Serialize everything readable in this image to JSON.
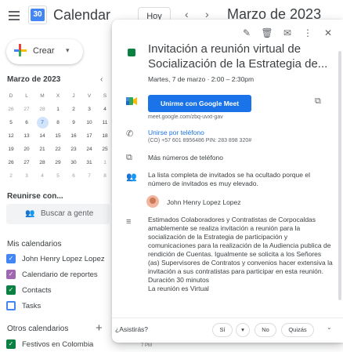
{
  "header": {
    "app_title": "Calendar",
    "logo_number": "30",
    "today_label": "Hoy",
    "prev": "‹",
    "next": "›",
    "month_title": "Marzo de 2023"
  },
  "sidebar": {
    "create_label": "Crear",
    "mini_title": "Marzo de 2023",
    "weekdays": [
      "D",
      "L",
      "M",
      "X",
      "J",
      "V",
      "S"
    ],
    "weeks": [
      [
        "26",
        "27",
        "28",
        "1",
        "2",
        "3",
        "4"
      ],
      [
        "5",
        "6",
        "7",
        "8",
        "9",
        "10",
        "11"
      ],
      [
        "12",
        "13",
        "14",
        "15",
        "16",
        "17",
        "18"
      ],
      [
        "19",
        "20",
        "21",
        "22",
        "23",
        "24",
        "25"
      ],
      [
        "26",
        "27",
        "28",
        "29",
        "30",
        "31",
        "1"
      ],
      [
        "2",
        "3",
        "4",
        "5",
        "6",
        "7",
        "8"
      ]
    ],
    "selected_day": "7",
    "find_title": "Reunirse con...",
    "find_label": "Buscar a gente",
    "my_calendars_title": "Mis calendarios",
    "my_calendars": [
      {
        "label": "John Henry Lopez Lopez",
        "color": "#4285f4",
        "checked": true
      },
      {
        "label": "Calendario de reportes",
        "color": "#9e69af",
        "checked": true
      },
      {
        "label": "Contacts",
        "color": "#0b8043",
        "checked": true
      },
      {
        "label": "Tasks",
        "color": "#4285f4",
        "checked": false
      }
    ],
    "other_calendars_title": "Otros calendarios",
    "other_calendars": [
      {
        "label": "Festivos en Colombia",
        "color": "#0b8043",
        "checked": true
      }
    ]
  },
  "time_hint": "7 PM",
  "event": {
    "color": "#0b8043",
    "title": "Invitación a reunión virtual de Socialización de la Estrategia de...",
    "when": "Martes, 7 de marzo · 2:00 – 2:30pm",
    "meet_button": "Unirme con Google Meet",
    "meet_link": "meet.google.com/zbq-uvxt-gav",
    "phone_title": "Unirse por teléfono",
    "phone_detail": "(CO) +57 601 8956486 PIN: 283 898 320#",
    "more_phones": "Más números de teléfono",
    "guests_note": "La lista completa de invitados se ha ocultado porque el número de invitados es muy elevado.",
    "organizer": "John Henry Lopez Lopez",
    "description": "Estimados  Colaboradores y Contratistas de Corpocaldas  amablemente se realiza invitación  a reunión para la  socialización de la Estrategia de participación  y comunicaciones  para la realización de la Audiencia publica  de rendición de Cuentas. Igualmente se solicita a los Señores (as) Supervisores de Contratos y convenios hacer extensiva la invitación a sus contratistas  para participar en esta reunión.\nDuración  30 minutos\nLa reunión es Virtual",
    "rsvp_question": "¿Asistirás?",
    "rsvp_yes": "Sí",
    "rsvp_no": "No",
    "rsvp_maybe": "Quizás"
  },
  "colors": {
    "accent": "#1a73e8",
    "event_green": "#0b8043",
    "selected_day_bg": "#d2e3fc"
  }
}
